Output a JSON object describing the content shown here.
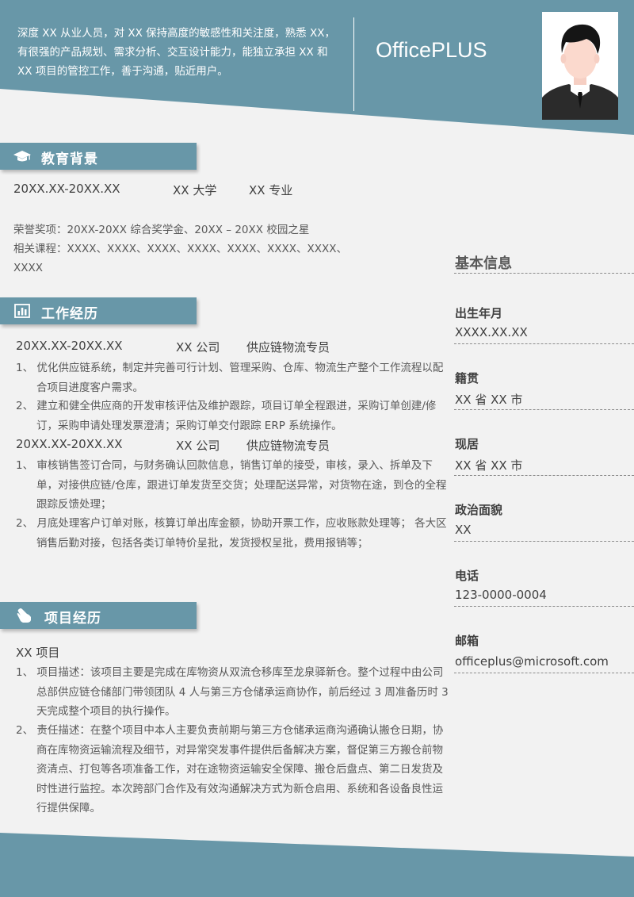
{
  "header": {
    "intro": "深度 XX 从业人员，对 XX 保持高度的敏感性和关注度，熟悉 XX，有很强的产品规划、需求分析、交互设计能力，能独立承担 XX 和 XX 项目的管控工作，善于沟通，贴近用户。",
    "brand": "OfficePLUS"
  },
  "theme": {
    "accent": "#6897a8",
    "background": "#f2f2f2"
  },
  "education": {
    "title": "教育背景",
    "icon": "graduation-cap-icon",
    "period": "20XX.XX-20XX.XX",
    "school": "XX 大学",
    "major": "XX 专业",
    "honors": "荣誉奖项：20XX-20XX  综合奖学金、20XX  –  20XX 校园之星",
    "courses": "相关课程：XXXX、XXXX、XXXX、XXXX、XXXX、XXXX、XXXX、XXXX"
  },
  "work": {
    "title": "工作经历",
    "icon": "bar-chart-icon",
    "jobs": [
      {
        "period": "20XX.XX-20XX.XX",
        "company": "XX 公司",
        "position": "供应链物流专员",
        "duties": [
          "1、 优化供应链系统，制定并完善可行计划、管理采购、仓库、物流生产整个工作流程以配合项目进度客户需求。",
          "2、 建立和健全供应商的开发审核评估及维护跟踪，项目订单全程跟进，采购订单创建/修订，采购申请处理发票澄清；采购订单交付跟踪 ERP 系统操作。"
        ]
      },
      {
        "period": "20XX.XX-20XX.XX",
        "company": "XX 公司",
        "position": "供应链物流专员",
        "duties": [
          "1、 审核销售签订合同，与财务确认回款信息，销售订单的接受，审核，录入、拆单及下单，对接供应链/仓库，跟进订单发货至交货；处理配送异常，对货物在途，到仓的全程跟踪反馈处理；",
          "2、 月底处理客户订单对账，核算订单出库金额，协助开票工作，应收账款处理等；  各大区销售后勤对接，包括各类订单特价呈批，发货授权呈批，费用报销等；"
        ]
      }
    ]
  },
  "project": {
    "title": "项目经历",
    "icon": "hand-pointer-icon",
    "name": "XX 项目",
    "items": [
      "1、 项目描述：该项目主要是完成在库物资从双流仓移库至龙泉驿新仓。整个过程中由公司总部供应链仓储部门带领团队 4 人与第三方仓储承运商协作，前后经过 3 周准备历时 3 天完成整个项目的执行操作。",
      "2、 责任描述：在整个项目中本人主要负责前期与第三方仓储承运商沟通确认搬仓日期，协商在库物资运输流程及细节，对异常突发事件提供后备解决方案，督促第三方搬仓前物资清点、打包等各项准备工作，对在途物资运输安全保障、搬仓后盘点、第二日发货及时性进行监控。本次跨部门合作及有效沟通解决方式为新仓启用、系统和各设备良性运行提供保障。"
    ]
  },
  "basic_info": {
    "title": "基本信息",
    "fields": [
      {
        "label": "出生年月",
        "value": "XXXX.XX.XX"
      },
      {
        "label": "籍贯",
        "value": "XX 省 XX 市"
      },
      {
        "label": "现居",
        "value": "XX 省 XX 市"
      },
      {
        "label": "政治面貌",
        "value": "XX"
      },
      {
        "label": "电话",
        "value": "123-0000-0004"
      },
      {
        "label": "邮箱",
        "value": "officeplus@microsoft.com"
      }
    ]
  }
}
